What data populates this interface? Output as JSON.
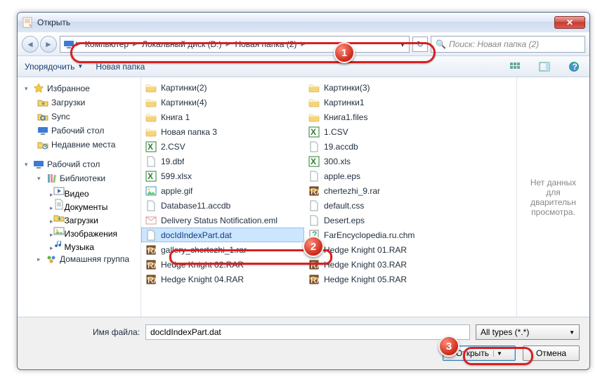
{
  "title": "Открыть",
  "breadcrumb": [
    "Компьютер",
    "Локальный диск (D:)",
    "Новая папка (2)"
  ],
  "search_placeholder": "Поиск: Новая папка (2)",
  "toolbar": {
    "organize": "Упорядочить",
    "newfolder": "Новая папка"
  },
  "nav": {
    "favorites": {
      "label": "Избранное",
      "items": [
        "Загрузки",
        "Sync",
        "Рабочий стол",
        "Недавние места"
      ]
    },
    "desktop": {
      "label": "Рабочий стол",
      "libraries": {
        "label": "Библиотеки",
        "items": [
          "Видео",
          "Документы",
          "Загрузки",
          "Изображения",
          "Музыка"
        ]
      },
      "homegroup": "Домашняя группа"
    }
  },
  "files": {
    "col1": [
      {
        "n": "Картинки(2)",
        "t": "folder"
      },
      {
        "n": "Картинки(4)",
        "t": "folder"
      },
      {
        "n": "Книга 1",
        "t": "folder"
      },
      {
        "n": "Новая папка 3",
        "t": "folder"
      },
      {
        "n": "2.CSV",
        "t": "xls"
      },
      {
        "n": "19.dbf",
        "t": "file"
      },
      {
        "n": "599.xlsx",
        "t": "xls"
      },
      {
        "n": "apple.gif",
        "t": "img"
      },
      {
        "n": "Database11.accdb",
        "t": "file"
      },
      {
        "n": "Delivery Status Notification.eml",
        "t": "mail"
      },
      {
        "n": "docIdIndexPart.dat",
        "t": "file",
        "sel": true
      },
      {
        "n": "gallery_chertezhi_1.rar",
        "t": "rar"
      },
      {
        "n": "Hedge Knight 02.RAR",
        "t": "rar"
      },
      {
        "n": "Hedge Knight 04.RAR",
        "t": "rar"
      }
    ],
    "col2": [
      {
        "n": "Картинки(3)",
        "t": "folder"
      },
      {
        "n": "Картинки1",
        "t": "folder"
      },
      {
        "n": "Книга1.files",
        "t": "folder"
      },
      {
        "n": "1.CSV",
        "t": "xls"
      },
      {
        "n": "19.accdb",
        "t": "file"
      },
      {
        "n": "300.xls",
        "t": "xls"
      },
      {
        "n": "apple.eps",
        "t": "file"
      },
      {
        "n": "chertezhi_9.rar",
        "t": "rar"
      },
      {
        "n": "default.css",
        "t": "file"
      },
      {
        "n": "Desert.eps",
        "t": "file"
      },
      {
        "n": "FarEncyclopedia.ru.chm",
        "t": "chm"
      },
      {
        "n": "Hedge Knight 01.RAR",
        "t": "rar"
      },
      {
        "n": "Hedge Knight 03.RAR",
        "t": "rar"
      },
      {
        "n": "Hedge Knight 05.RAR",
        "t": "rar"
      }
    ]
  },
  "preview_text": "Нет данных для дварительн просмотра.",
  "footer": {
    "filename_label": "Имя файла:",
    "filename_value": "docIdIndexPart.dat",
    "filter": "All types (*.*)",
    "open": "Открыть",
    "cancel": "Отмена"
  },
  "icons": {
    "folder": "<svg width=16 height=16 viewBox='0 0 16 16'><path class='svgfolder' d='M1 4h5l1 2h8v7a1 1 0 0 1-1 1H2a1 1 0 0 1-1-1z'/><path fill='#fff1c1' d='M1 4h5l1 2h8v1H1z'/></svg>",
    "xls": "<svg width=16 height=16><rect x='1' y='1' width='14' height='14' fill='#fff' stroke='#2e7d32'/><text x='3' y='12' font-size='8' fill='#2e7d32' font-weight='bold'>X</text></svg>",
    "file": "<svg width=16 height=16><path fill='#fff' stroke='#9aa' d='M3 1h7l3 3v11H3z'/><path fill='#dde' d='M10 1v3h3'/></svg>",
    "img": "<svg width=16 height=16><rect x='1' y='2' width='14' height='12' fill='#fff' stroke='#39c'/><circle cx='5' cy='6' r='1.5' fill='#fc3'/><path fill='#6c6' d='M2 13l4-5 3 3 2-2 3 4z'/></svg>",
    "rar": "<svg width=16 height=16><rect x='2' y='2' width='12' height='12' fill='#8b5a2b' stroke='#5a3a18'/><rect x='2' y='5' width='12' height='3' fill='#d4a04a'/><text x='3' y='13' font-size='6' fill='#fff'>RAR</text></svg>",
    "mail": "<svg width=16 height=16><rect x='1' y='3' width='14' height='10' fill='#fff' stroke='#d99'/><path stroke='#d99' fill='none' d='M1 3l7 5 7-5'/></svg>",
    "chm": "<svg width=16 height=16><rect x='2' y='1' width='12' height='14' fill='#fff' stroke='#888'/><text x='5' y='11' font-size='9' fill='#3a7' font-weight='bold'>?</text></svg>",
    "star": "<svg width=16 height=16 viewBox='0 0 16 16'><path fill='#f7c948' stroke='#caa11e' stroke-width='.6' d='M8 1.5l1.9 4 4.3.4-3.2 2.9.9 4.2L8 11l-3.9 2 1-4.2L1.8 5.9l4.3-.4z'/></svg>",
    "dl": "<svg width=16 height=16><path fill='#f6d478' stroke='#c99a2e' d='M1 5h5l1 2h8v6H1z'/><path fill='#3a8' d='M8 6v3H6l2.5 3L11 9H9V6z'/></svg>",
    "sync": "<svg width=16 height=16><path fill='#f6d478' stroke='#c99a2e' d='M1 5h5l1 2h8v6H1z'/><path fill='none' stroke='#27a' stroke-width='1.5' d='M5 10a3 3 0 0 1 6 0M11 10a3 3 0 0 1-6 0'/></svg>",
    "desk": "<svg width=16 height=16><rect x='1' y='3' width='14' height='8' fill='#3b7bd1' rx='1'/><rect x='5' y='12' width='6' height='2' fill='#888'/></svg>",
    "recent": "<svg width=16 height=16><path fill='#f6d478' stroke='#c99a2e' d='M1 5h5l1 2h8v6H1z'/><circle cx='11' cy='11' r='3' fill='#fff' stroke='#27a'/><path stroke='#27a' d='M11 9v2h1.5'/></svg>",
    "lib": "<svg width=16 height=16><rect x='3' y='2' width='3' height='12' fill='#6ab'/><rect x='7' y='2' width='3' height='12' fill='#e8a'/><rect x='11' y='3' width='3' height='11' fill='#8c6' transform='rotate(8 12 9)'/></svg>",
    "vid": "<svg width=16 height=16><rect x='1' y='3' width='14' height='10' fill='#fff' stroke='#888'/><path fill='#37b' d='M6 5v6l5-3z'/></svg>",
    "doc": "<svg width=16 height=16><path fill='#fff' stroke='#9aa' d='M3 1h7l3 3v11H3z'/><path stroke='#9aa' d='M5 6h6M5 8h6M5 10h6'/></svg>",
    "pic": "<svg width=16 height=16><rect x='1' y='3' width='14' height='10' fill='#fff' stroke='#888'/><circle cx='5' cy='7' r='1.5' fill='#fc3'/><path fill='#6c6' d='M2 12l4-4 3 3 2-2 3 3z'/></svg>",
    "mus": "<svg width=16 height=16><path fill='#37b' d='M6 3v7a2 2 0 1 1-1-1.7V4l6-1v6a2 2 0 1 1-1-1.7V3z'/></svg>",
    "hg": "<svg width=16 height=16><circle cx='5' cy='6' r='2.5' fill='#6ab04a'/><circle cx='11' cy='6' r='2.5' fill='#4a90d9'/><circle cx='8' cy='11' r='2.5' fill='#e8a13a'/></svg>",
    "help": "<svg width=16 height=16><circle cx='8' cy='8' r='6.5' fill='#4a90d9' stroke='#2a6'/><text x='5.5' y='12' fill='#fff' font-size='10' font-weight='bold'>?</text></svg>",
    "view": "<svg width=16 height=16><rect x='1' y='2' width='4' height='4' fill='#6a9'/><rect x='6' y='2' width='4' height='4' fill='#6a9'/><rect x='11' y='2' width='4' height='4' fill='#6a9'/><rect x='1' y='7' width='4' height='4' fill='#6a9'/><rect x='6' y='7' width='4' height='4' fill='#6a9'/><rect x='11' y='7' width='4' height='4' fill='#6a9'/></svg>",
    "pane": "<svg width=16 height=16><rect x='1' y='2' width='14' height='12' fill='none' stroke='#4a7'/><rect x='10' y='2' width='5' height='12' fill='#bde'/></svg>",
    "note": "<svg width=16 height=16><rect x='2' y='1' width='12' height='14' fill='#fffde7' stroke='#caa'/><path stroke='#caa' d='M4 4h8M4 6h8M4 8h8'/><path fill='#e8a' d='M11 10l3 3-1 1-3-3z'/></svg>"
  }
}
